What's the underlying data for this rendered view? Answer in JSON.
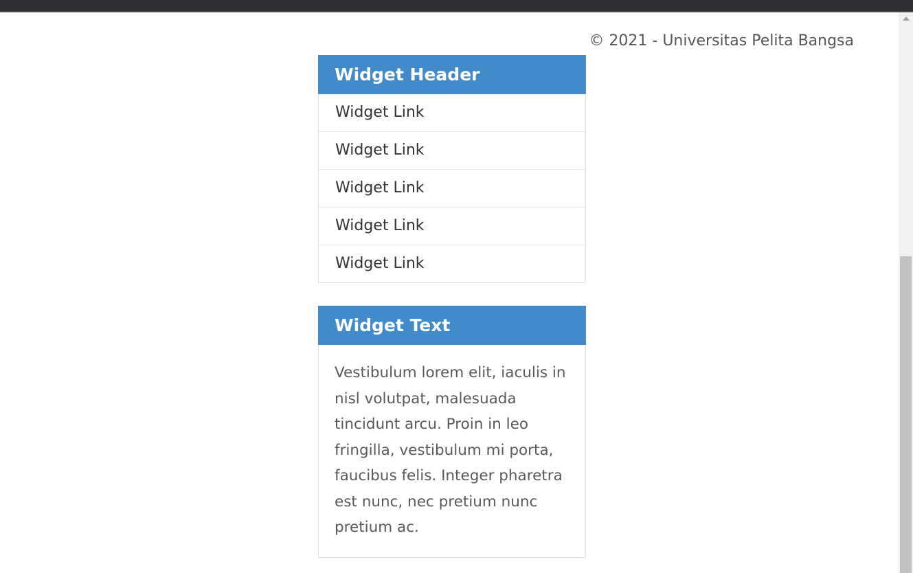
{
  "footer": {
    "copyright": "© 2021 - Universitas Pelita Bangsa"
  },
  "widgets": {
    "links": {
      "header": "Widget Header",
      "items": [
        "Widget Link",
        "Widget Link",
        "Widget Link",
        "Widget Link",
        "Widget Link"
      ]
    },
    "text": {
      "header": "Widget Text",
      "body": "Vestibulum lorem elit, iaculis in nisl volutpat, malesuada tincidunt arcu. Proin in leo fringilla, vestibulum mi porta, faucibus felis. Integer pharetra est nunc, nec pretium nunc pretium ac."
    }
  },
  "colors": {
    "widget_header_bg": "#418bca",
    "topbar_bg": "#2f3035"
  }
}
